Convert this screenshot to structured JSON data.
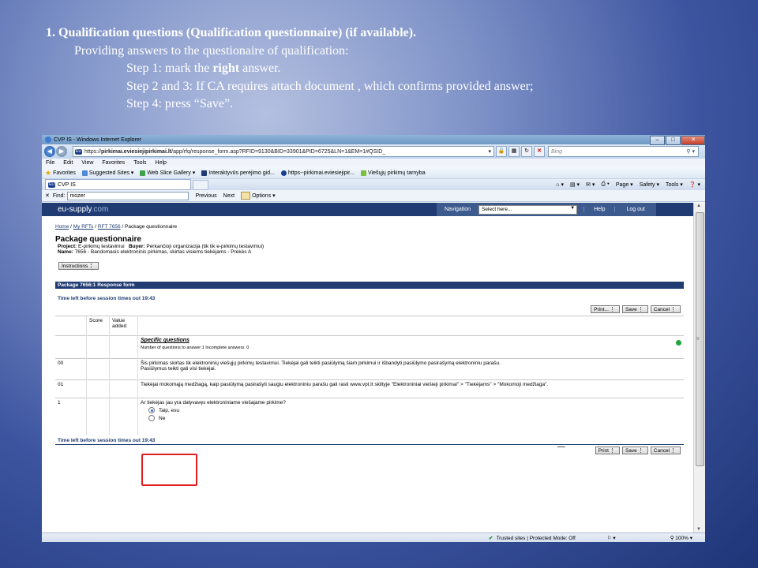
{
  "slide": {
    "title": "1. Qualification questions (Qualification questionnaire) (if available).",
    "intro": "Providing answers to the questionaire of qualification:",
    "step1_pre": "Step 1: mark the ",
    "step1_bold": "right",
    "step1_post": " answer.",
    "step23": "Step 2 and 3: If CA requires attach document , which confirms provided answer;",
    "step4": "Step 4: press “Save”."
  },
  "browser": {
    "window_title": "CVP IS - Windows Internet Explorer",
    "url_prefix": "https://",
    "url_domain": "pirkimai.eviesiejipirkimai.lt",
    "url_path": "/app/rfq/response_form.asp?RFID=9130&BID=33901&PID=6725&LN=1&EM=1#QSID_",
    "search_placeholder": "Bing",
    "menu": [
      "File",
      "Edit",
      "View",
      "Favorites",
      "Tools",
      "Help"
    ],
    "favorites_label": "Favorites",
    "favorites": [
      "Suggested Sites ▾",
      "Web Slice Gallery ▾",
      "Interaktyvūs perėjimo gid...",
      "https--pirkimai.eviesiejipir...",
      "Viešųjų pirkimų tarnyba"
    ],
    "tab_title": "CVP IS",
    "commands": [
      "Page ▾",
      "Safety ▾",
      "Tools ▾"
    ],
    "find_label": "Find:",
    "find_value": "mozer",
    "find_previous": "Previous",
    "find_next": "Next",
    "find_options": "Options ▾",
    "status_security": "Trusted sites | Protected Mode: Off",
    "zoom": "100%"
  },
  "site": {
    "logo_main": "eu-supply",
    "logo_suffix": ".com",
    "navigation_label": "Navigation",
    "navigation_select": "Select here...",
    "help": "Help",
    "logout": "Log out",
    "breadcrumb": [
      "Home",
      "My RFTs",
      "RFT 7656",
      "Package questionnaire"
    ],
    "page_title": "Package questionnaire",
    "project_label": "Project:",
    "project_value": "E-pirkimų testavimui",
    "buyer_label": "Buyer:",
    "buyer_value": "Perkančioji organizacija (tik tik e-pirkimų testavimui)",
    "name_label": "Name:",
    "name_value": "7656 - Bandomasis elektroninis pirkimas, skirtas visiems tiekėjams - Prekės A",
    "instructions_btn": "Instructions",
    "form_header": "Package 7656:1 Response form",
    "time_left": "Time left before session times out  19:43",
    "print_btn": "Print...",
    "save_btn": "Save",
    "cancel_btn": "Cancel",
    "col_score": "Score",
    "col_value_added": "Value added",
    "specific_questions": "Specific questions",
    "counts": "Number of questions to answer:1  Incomplete answers: 0",
    "rows": [
      {
        "id": "00",
        "text": "Šis pirkimas skirtas tik elektroninių viešųjų pirkimų testavimui. Tiekėjai gali teikti pasiūlymą šiam pirkimui ir išbandyti pasiūlymo pasirašymą elektroniniu parašu.",
        "text2": "Pasiūlymus teikti gali visi tiekėjai."
      },
      {
        "id": "01",
        "text": "Tiekėjai mokomąją medžiagą, kaip pasiūlymą pasirašyti saugiu elektroniniu parašu gali rasti www.vpt.lt skiltyje \"Elektroniniai viešieji pirkimai\" > \"Tiekėjams\" > \"Mokomoji medžiaga\".",
        "text2": ""
      },
      {
        "id": "1",
        "text": "Ar tiekėjas jau yra dalyvavęs elektroniniame viešajame pirkime?",
        "text2": ""
      }
    ],
    "option_yes": "Taip, esu",
    "option_no": "Ne",
    "time_left_bottom": "Time left before session times out  19:43",
    "print_btn2": "Print",
    "save_btn2": "Save",
    "cancel_btn2": "Cancel"
  }
}
